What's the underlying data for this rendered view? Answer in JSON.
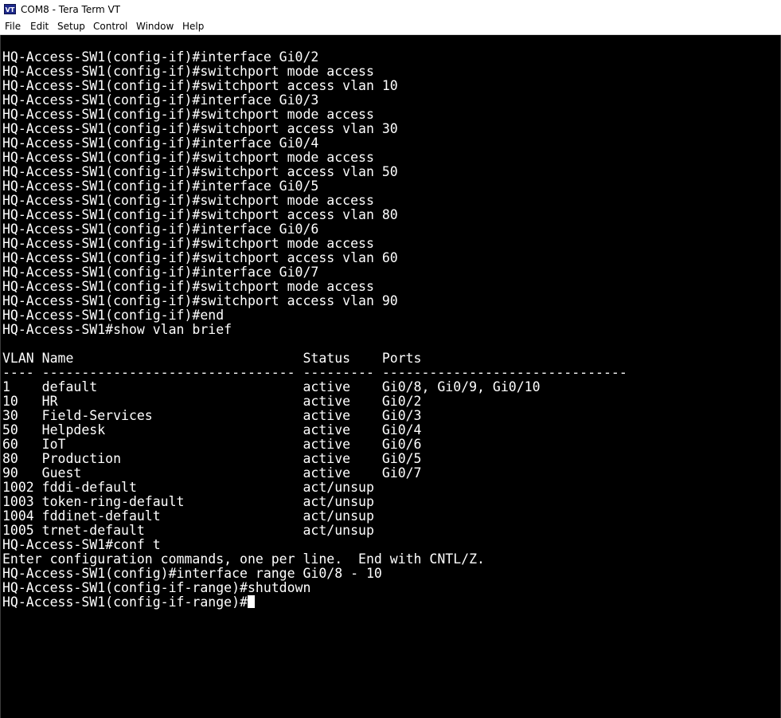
{
  "window": {
    "title": "COM8 - Tera Term VT",
    "icon_text": "VT"
  },
  "menu": [
    "File",
    "Edit",
    "Setup",
    "Control",
    "Window",
    "Help"
  ],
  "terminal": {
    "lines": [
      "HQ-Access-SW1(config-if)#interface Gi0/2",
      "HQ-Access-SW1(config-if)#switchport mode access",
      "HQ-Access-SW1(config-if)#switchport access vlan 10",
      "HQ-Access-SW1(config-if)#interface Gi0/3",
      "HQ-Access-SW1(config-if)#switchport mode access",
      "HQ-Access-SW1(config-if)#switchport access vlan 30",
      "HQ-Access-SW1(config-if)#interface Gi0/4",
      "HQ-Access-SW1(config-if)#switchport mode access",
      "HQ-Access-SW1(config-if)#switchport access vlan 50",
      "HQ-Access-SW1(config-if)#interface Gi0/5",
      "HQ-Access-SW1(config-if)#switchport mode access",
      "HQ-Access-SW1(config-if)#switchport access vlan 80",
      "HQ-Access-SW1(config-if)#interface Gi0/6",
      "HQ-Access-SW1(config-if)#switchport mode access",
      "HQ-Access-SW1(config-if)#switchport access vlan 60",
      "HQ-Access-SW1(config-if)#interface Gi0/7",
      "HQ-Access-SW1(config-if)#switchport mode access",
      "HQ-Access-SW1(config-if)#switchport access vlan 90",
      "HQ-Access-SW1(config-if)#end",
      "HQ-Access-SW1#show vlan brief",
      "",
      "VLAN Name                             Status    Ports",
      "---- -------------------------------- --------- -------------------------------",
      "1    default                          active    Gi0/8, Gi0/9, Gi0/10",
      "10   HR                               active    Gi0/2",
      "30   Field-Services                   active    Gi0/3",
      "50   Helpdesk                         active    Gi0/4",
      "60   IoT                              active    Gi0/6",
      "80   Production                       active    Gi0/5",
      "90   Guest                            active    Gi0/7",
      "1002 fddi-default                     act/unsup",
      "1003 token-ring-default               act/unsup",
      "1004 fddinet-default                  act/unsup",
      "1005 trnet-default                    act/unsup",
      "HQ-Access-SW1#conf t",
      "Enter configuration commands, one per line.  End with CNTL/Z.",
      "HQ-Access-SW1(config)#interface range Gi0/8 - 10",
      "HQ-Access-SW1(config-if-range)#shutdown",
      "HQ-Access-SW1(config-if-range)#"
    ]
  }
}
